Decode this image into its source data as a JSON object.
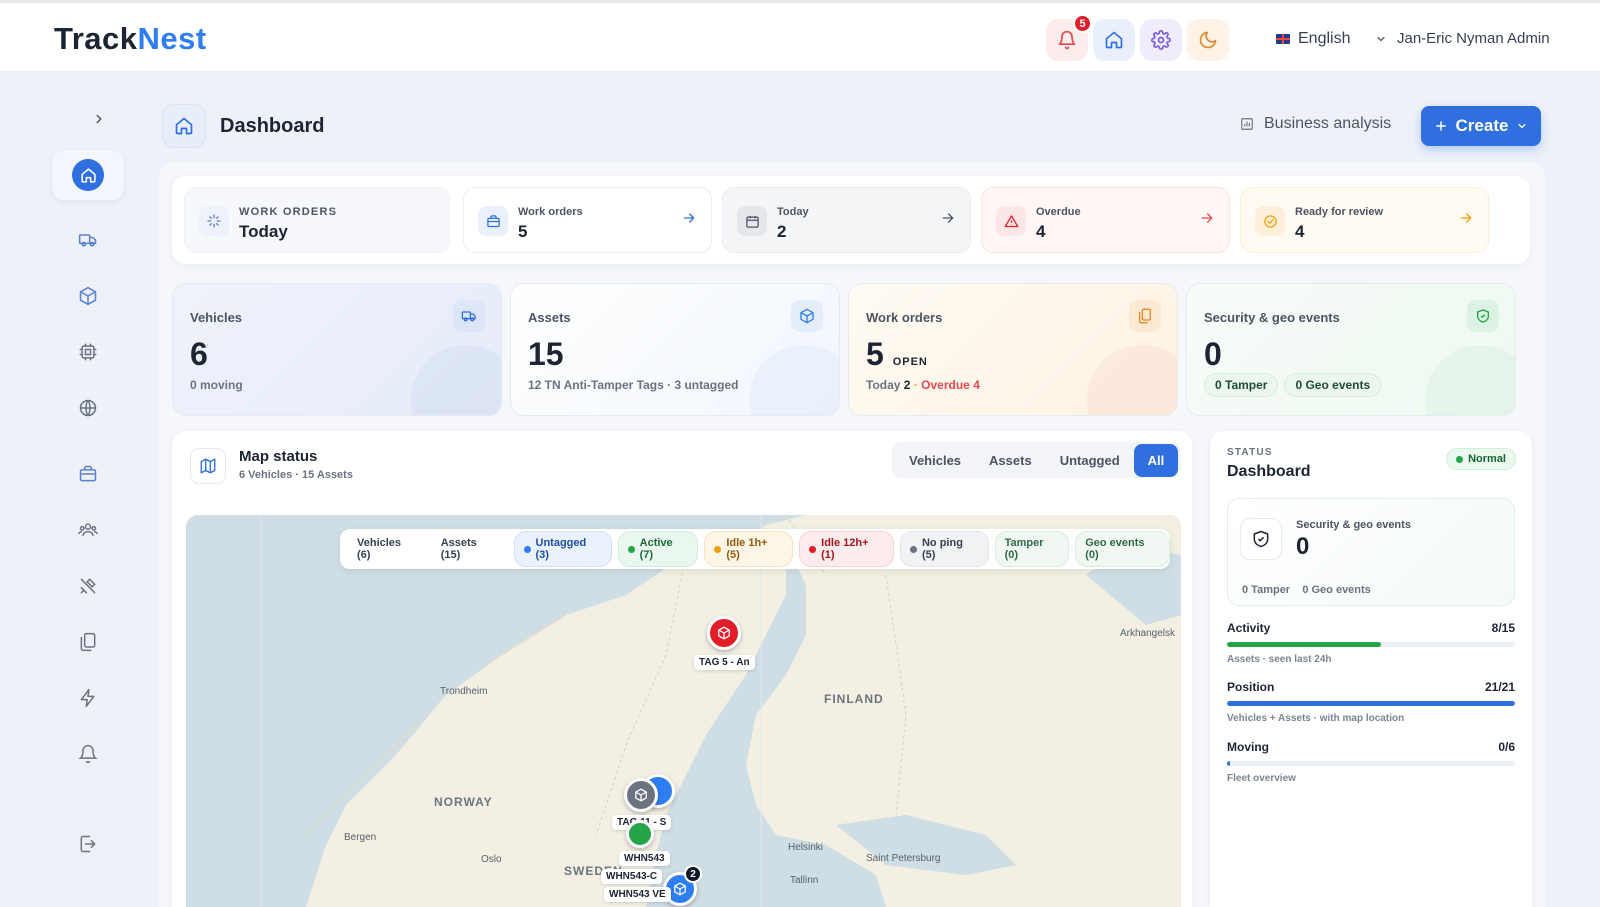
{
  "header": {
    "logo_part1": "Track",
    "logo_part2": "Nest",
    "notification_count": "5",
    "language": "English",
    "user": "Jan-Eric Nyman Admin",
    "icons": [
      "bell-icon",
      "home-icon",
      "gear-icon",
      "moon-icon"
    ]
  },
  "page": {
    "title": "Dashboard",
    "business_analysis": "Business analysis",
    "create_label": "Create"
  },
  "work_orders_strip": {
    "kicker": "WORK ORDERS",
    "period": "Today",
    "cards": [
      {
        "label": "Work orders",
        "value": "5",
        "accent": "#2f6fe0"
      },
      {
        "label": "Today",
        "value": "2",
        "accent": "#6b7280"
      },
      {
        "label": "Overdue",
        "value": "4",
        "accent": "#e11d28"
      },
      {
        "label": "Ready for review",
        "value": "4",
        "accent": "#f59e0b"
      }
    ]
  },
  "stats": {
    "vehicles": {
      "label": "Vehicles",
      "value": "6",
      "sub": "0 moving"
    },
    "assets": {
      "label": "Assets",
      "value": "15",
      "sub": "12 TN Anti-Tamper Tags · 3 untagged"
    },
    "work_orders": {
      "label": "Work orders",
      "value": "5",
      "value_suffix": "OPEN",
      "today_label": "Today",
      "today_value": "2",
      "overdue": "Overdue 4"
    },
    "security": {
      "label": "Security & geo events",
      "value": "0",
      "tamper": "0 Tamper",
      "geo": "0 Geo events"
    }
  },
  "map": {
    "title": "Map status",
    "subtitle": "6 Vehicles · 15 Assets",
    "tabs": [
      "Vehicles",
      "Assets",
      "Untagged",
      "All"
    ],
    "active_tab": "All",
    "filters": [
      {
        "label": "Vehicles (6)",
        "color": ""
      },
      {
        "label": "Assets (15)",
        "color": ""
      },
      {
        "label": "Untagged (3)",
        "color": "#2f7ef1"
      },
      {
        "label": "Active (7)",
        "color": "#22a447"
      },
      {
        "label": "Idle 1h+ (5)",
        "color": "#f59e0b"
      },
      {
        "label": "Idle 12h+ (1)",
        "color": "#e11d28"
      },
      {
        "label": "No ping (5)",
        "color": "#6b7280"
      },
      {
        "label": "Tamper (0)",
        "color": ""
      },
      {
        "label": "Geo events (0)",
        "color": ""
      }
    ],
    "places": [
      "Arkhangelsk",
      "Trondheim",
      "FINLAND",
      "NORWAY",
      "Bergen",
      "Oslo",
      "SWEDEN",
      "Helsinki",
      "Saint Petersburg",
      "Tallinn"
    ],
    "markers": {
      "tag5": "TAG 5 - An",
      "tag11": "TAG 11 - S",
      "whn1": "WHN543",
      "whn2": "WHN543-C",
      "whn3": "WHN543 VE",
      "cluster_count": "2"
    }
  },
  "status_panel": {
    "kicker": "STATUS",
    "title": "Dashboard",
    "state": "Normal",
    "security_label": "Security & geo events",
    "security_value": "0",
    "tamper": "0 Tamper",
    "geo": "0 Geo events",
    "meters": [
      {
        "label": "Activity",
        "value": "8/15",
        "fraction": 0.533,
        "caption": "Assets · seen last 24h",
        "color": "#22a447"
      },
      {
        "label": "Position",
        "value": "21/21",
        "fraction": 1.0,
        "caption": "Vehicles + Assets · with map location",
        "color": "#2f6fe0"
      },
      {
        "label": "Moving",
        "value": "0/6",
        "fraction": 0.0,
        "caption": "Fleet overview",
        "color": "#2f6fe0"
      }
    ]
  }
}
